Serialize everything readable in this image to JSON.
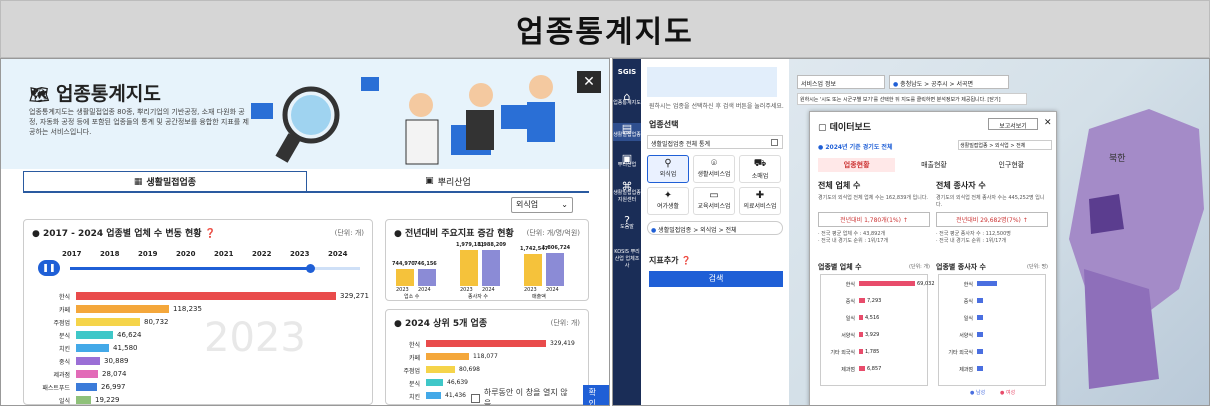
{
  "banner": {
    "title": "업종통계지도"
  },
  "left": {
    "title": "업종통계지도",
    "desc": "업종통계지도는 생활밀접업종 80종, 뿌리기업의 기반공정, 소재 다원화 공정, 자동화 공정 등에 포함된 업종들의 통계 및 공간정보를 융합한 지표를 제공하는 서비스입니다.",
    "tabs": [
      "생활밀접업종",
      "뿌리산업"
    ],
    "select": "외식업",
    "trend": {
      "title": "2017 - 2024 업종별 업체 수 변동 현황",
      "unit": "(단위: 개)",
      "years": [
        "2017",
        "2018",
        "2019",
        "2020",
        "2021",
        "2022",
        "2023",
        "2024"
      ],
      "watermark": "2023",
      "bars": [
        {
          "label": "한식",
          "value": "329,271"
        },
        {
          "label": "카페",
          "value": "118,235"
        },
        {
          "label": "주점업",
          "value": "80,732"
        },
        {
          "label": "분식",
          "value": "46,624"
        },
        {
          "label": "치킨",
          "value": "41,580"
        },
        {
          "label": "중식",
          "value": "30,889"
        },
        {
          "label": "제과점",
          "value": "28,074"
        },
        {
          "label": "패스트푸드",
          "value": "26,997"
        },
        {
          "label": "일식",
          "value": "19,229"
        }
      ]
    },
    "change": {
      "title": "전년대비 주요지표 증감 현황",
      "unit": "(단위: 개/명/억원)",
      "groups": [
        {
          "label": "업소 수",
          "a": "744,970",
          "b": "746,156"
        },
        {
          "label": "종사자 수",
          "a": "1,979,181",
          "b": "1,988,209"
        },
        {
          "label": "매출액",
          "a": "1,742,547",
          "b": "1,806,724"
        }
      ],
      "yrs": [
        "2023",
        "2024"
      ]
    },
    "top5": {
      "title": "2024 상위 5개 업종",
      "unit": "(단위: 개)",
      "rows": [
        {
          "label": "한식",
          "value": "329,419"
        },
        {
          "label": "카페",
          "value": "118,077"
        },
        {
          "label": "주점업",
          "value": "80,698"
        },
        {
          "label": "분식",
          "value": "46,639"
        },
        {
          "label": "치킨",
          "value": "41,436"
        }
      ]
    },
    "footer": {
      "hide": "하루동안 이 창을 열지 않음",
      "ok": "확인"
    }
  },
  "right": {
    "sidebar": [
      "업종통계지도",
      "생활밀접업종",
      "뿌리산업",
      "생활밀접업종지원센터",
      "도움말",
      "KOSIS 뿌리산업 업체조사"
    ],
    "hint": "원하시는 업종을 선택하신 후 검색 버튼을 눌러주세요.",
    "section": "업종선택",
    "all": "생활밀접업종 전체 통계",
    "cats": [
      "외식업",
      "생활서비스업",
      "소매업",
      "여가생활",
      "교육서비스업",
      "의료서비스업"
    ],
    "path": "생활밀접업종 > 외식업 > 전체",
    "add": "지표추가",
    "search": "검색",
    "map": {
      "region": "서비스업 정보",
      "loc": "충청남도 > 공주시 > 서곡면",
      "note": "원하시는 '시도 또는 시군구별 보기'를 선택한 뒤 지도를 클릭하면 분석정보가 제공됩니다. [닫기]",
      "north": "북한"
    },
    "dash": {
      "title": "데이터보드",
      "report": "보고서보기",
      "basis": "2024년 기준 경기도 전체",
      "crumb": "생활밀접업종 > 외식업 > 전체",
      "tabs": [
        "업종현황",
        "매출현황",
        "인구현황"
      ],
      "k1": {
        "title": "전체 업체 수",
        "desc": "경기도의 외식업 전체 업체 수는 162,839개 입니다.",
        "chg": "전년대비 1,780개(1%)",
        "n1": "· 전국 평균 업체 수 : 43,892개",
        "n2": "· 전국 내 경기도 순위 : 1위/17개"
      },
      "k2": {
        "title": "전체 종사자 수",
        "desc": "경기도의 외식업 전체 종사자 수는 445,252명 입니다.",
        "chg": "전년대비 29,682명(7%)",
        "n1": "· 전국 평균 종사자 수 : 112,500명",
        "n2": "· 전국 내 경기도 순위 : 1위/17개"
      },
      "c1": {
        "title": "업종별 업체 수",
        "unit": "(단위: 개)",
        "rows": [
          {
            "l": "한식",
            "v": "69,032"
          },
          {
            "l": "중식",
            "v": "7,293"
          },
          {
            "l": "일식",
            "v": "4,516"
          },
          {
            "l": "서양식",
            "v": "3,929"
          },
          {
            "l": "기타 외국식",
            "v": "1,785"
          },
          {
            "l": "제과점",
            "v": "6,857"
          }
        ]
      },
      "c2": {
        "title": "업종별 종사자 수",
        "unit": "(단위: 명)",
        "rows": [
          {
            "l": "한식"
          },
          {
            "l": "중식"
          },
          {
            "l": "일식"
          },
          {
            "l": "서양식"
          },
          {
            "l": "기타 외국식"
          },
          {
            "l": "제과점"
          }
        ],
        "legend": [
          "남성",
          "여성"
        ]
      }
    }
  }
}
